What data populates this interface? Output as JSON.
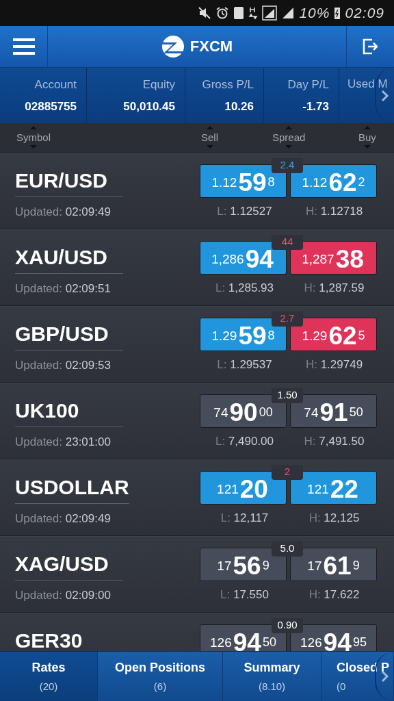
{
  "status_bar": {
    "battery": "10%",
    "time": "02:09"
  },
  "header": {
    "title": "FXCM"
  },
  "account_strip": [
    {
      "label": "Account",
      "value": "02885755"
    },
    {
      "label": "Equity",
      "value": "50,010.45"
    },
    {
      "label": "Gross P/L",
      "value": "10.26"
    },
    {
      "label": "Day P/L",
      "value": "-1.73"
    },
    {
      "label": "Used M"
    }
  ],
  "columns": [
    "Symbol",
    "Sell",
    "Spread",
    "Buy"
  ],
  "rates": [
    {
      "symbol": "EUR/USD",
      "updated_label": "Updated:",
      "updated": "02:09:49",
      "spread": {
        "text": "2.4",
        "color": "#3aa0e6"
      },
      "sell": {
        "pre": "1.12",
        "big": "59",
        "post": "8",
        "color": "#2196dc"
      },
      "buy": {
        "pre": "1.12",
        "big": "62",
        "post": "2",
        "color": "#2196dc"
      },
      "low_label": "L:",
      "low": "1.12527",
      "high_label": "H:",
      "high": "1.12718"
    },
    {
      "symbol": "XAU/USD",
      "updated_label": "Updated:",
      "updated": "02:09:51",
      "spread": {
        "text": "44",
        "color": "#f04f70"
      },
      "sell": {
        "pre": "1,286",
        "big": "94",
        "color": "#2196dc"
      },
      "buy": {
        "pre": "1,287",
        "big": "38",
        "color": "#e0335a"
      },
      "low_label": "L:",
      "low": "1,285.93",
      "high_label": "H:",
      "high": "1,287.59"
    },
    {
      "symbol": "GBP/USD",
      "updated_label": "Updated:",
      "updated": "02:09:53",
      "spread": {
        "text": "2.7",
        "color": "#f04f70"
      },
      "sell": {
        "pre": "1.29",
        "big": "59",
        "post": "8",
        "color": "#2196dc"
      },
      "buy": {
        "pre": "1.29",
        "big": "62",
        "post": "5",
        "color": "#e0335a"
      },
      "low_label": "L:",
      "low": "1.29537",
      "high_label": "H:",
      "high": "1.29749"
    },
    {
      "symbol": "UK100",
      "updated_label": "Updated:",
      "updated": "23:01:00",
      "spread": {
        "text": "1.50",
        "color": "#ffffff"
      },
      "sell": {
        "pre": "74",
        "big": "90",
        "post": "00",
        "color": "#464c59"
      },
      "buy": {
        "pre": "74",
        "big": "91",
        "post": "50",
        "color": "#464c59"
      },
      "low_label": "L:",
      "low": "7,490.00",
      "high_label": "H:",
      "high": "7,491.50"
    },
    {
      "symbol": "USDOLLAR",
      "updated_label": "Updated:",
      "updated": "02:09:49",
      "spread": {
        "text": "2",
        "color": "#f04f70"
      },
      "sell": {
        "pre": "121",
        "big": "20",
        "color": "#2196dc"
      },
      "buy": {
        "pre": "121",
        "big": "22",
        "color": "#2196dc"
      },
      "low_label": "L:",
      "low": "12,117",
      "high_label": "H:",
      "high": "12,125"
    },
    {
      "symbol": "XAG/USD",
      "updated_label": "Updated:",
      "updated": "02:09:00",
      "spread": {
        "text": "5.0",
        "color": "#ffffff"
      },
      "sell": {
        "pre": "17",
        "big": "56",
        "post": "9",
        "color": "#464c59"
      },
      "buy": {
        "pre": "17",
        "big": "61",
        "post": "9",
        "color": "#464c59"
      },
      "low_label": "L:",
      "low": "17.550",
      "high_label": "H:",
      "high": "17.622"
    },
    {
      "symbol": "GER30",
      "spread": {
        "text": "0.90",
        "color": "#ffffff"
      },
      "sell": {
        "pre": "126",
        "big": "94",
        "post": "50",
        "color": "#464c59"
      },
      "buy": {
        "pre": "126",
        "big": "94",
        "post": "95",
        "color": "#464c59"
      }
    }
  ],
  "tabs": [
    {
      "label": "Rates",
      "count": "(20)",
      "selected": true
    },
    {
      "label": "Open Positions",
      "count": "(6)",
      "selected": false
    },
    {
      "label": "Summary",
      "count": "(8.10)",
      "selected": false
    },
    {
      "label": "Closed P",
      "count": "(0",
      "selected": false
    }
  ]
}
